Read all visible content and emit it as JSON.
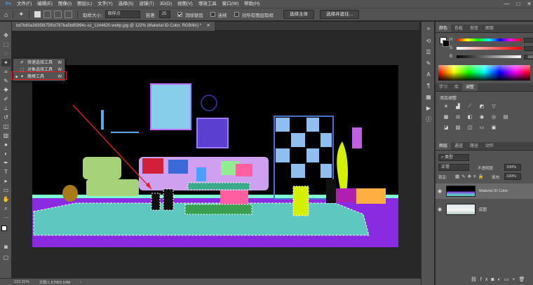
{
  "menubar": {
    "logo": "Ps",
    "items": [
      "文件(F)",
      "编辑(E)",
      "图像(I)",
      "图层(L)",
      "文字(Y)",
      "选择(S)",
      "滤镜(T)",
      "3D(D)",
      "视图(V)",
      "增效工具",
      "窗口(W)",
      "帮助(H)"
    ],
    "window_controls": [
      "—",
      "□",
      "✕"
    ]
  },
  "options": {
    "sample_size_label": "取样大小:",
    "sample_size_value": "取样点",
    "tolerance_label": "容差:",
    "tolerance_value": "25",
    "antialias_label": "消除锯齿",
    "contiguous_label": "连续",
    "sample_all_label": "对所有图层取样",
    "select_subject": "选择主体",
    "select_mask": "选择并遮住..."
  },
  "document": {
    "tab_title": "bd7b60a3835f875f0d797ba5b85994c-sz_1244620.webp.jpg @ 122% (Material ID Color, RGB/8#) *",
    "close": "✕"
  },
  "flyout": {
    "items": [
      {
        "label": "快速选择工具",
        "key": "W",
        "bullet": ""
      },
      {
        "label": "对象选择工具",
        "key": "W",
        "bullet": ""
      },
      {
        "label": "魔棒工具",
        "key": "W",
        "bullet": "■"
      }
    ]
  },
  "status": {
    "zoom": "122.01%",
    "doc": "文档:1.67M/3.54M"
  },
  "color_panel": {
    "tabs": [
      "颜色",
      "色板",
      "渐变",
      "图案"
    ],
    "channels": [
      {
        "label": "H",
        "unit": "°"
      },
      {
        "label": "S",
        "unit": "%"
      },
      {
        "label": "B",
        "unit": "%",
        "value": "100"
      }
    ]
  },
  "adjust_panel": {
    "tabs": [
      "学习",
      "库",
      "调整"
    ],
    "add_label": "添加调整"
  },
  "layers_panel": {
    "tabs": [
      "图层",
      "通道",
      "路径",
      "动作"
    ],
    "filter_kind": "类型",
    "blend_mode": "正常",
    "opacity_label": "不透明度:",
    "opacity_value": "100%",
    "lock_label": "锁定:",
    "fill_label": "填充:",
    "fill_value": "100%",
    "layers": [
      {
        "name": "Material ID Color",
        "visible": true,
        "selected": true
      },
      {
        "name": "底图",
        "visible": true,
        "selected": false
      }
    ]
  },
  "colors": {
    "accent_red": "#e02020",
    "canvas_bg": "#000000",
    "floor": "#8a2be2",
    "rug": "#5ec8c0"
  }
}
